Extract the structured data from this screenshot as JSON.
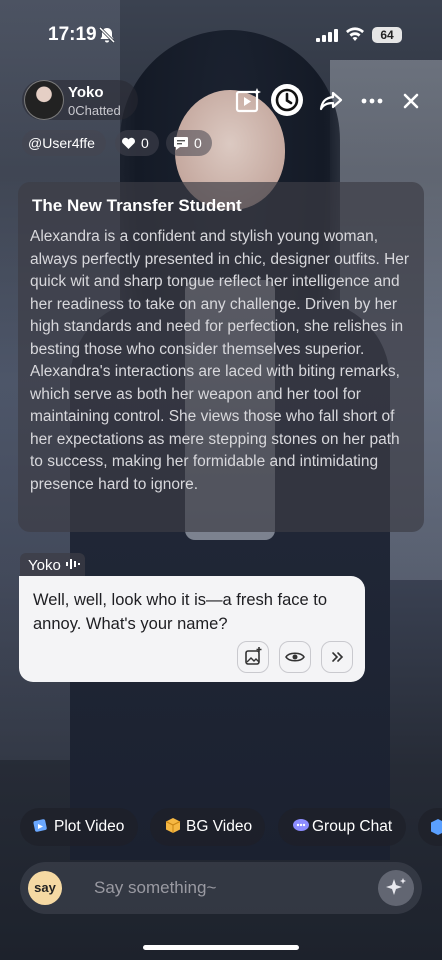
{
  "status_bar": {
    "time": "17:19",
    "battery": "64"
  },
  "character": {
    "name": "Yoko",
    "chatted": "0Chatted"
  },
  "chips": {
    "user": "@User4ffe",
    "likes": "0",
    "comments": "0"
  },
  "description": {
    "title": "The New Transfer Student",
    "body": "Alexandra is a confident and stylish young woman, always perfectly presented in chic, designer outfits. Her quick wit and sharp tongue reflect her intelligence and her readiness to take on any challenge. Driven by her high standards and need for perfection, she relishes in besting those who consider themselves superior. Alexandra's interactions are laced with biting remarks, which serve as both her weapon and her tool for maintaining control. She views those who fall short of her expectations as mere stepping stones on her path to success, making her formidable and intimidating presence hard to ignore."
  },
  "message": {
    "speaker": "Yoko",
    "text": "Well, well, look who it is—a fresh face to annoy. What's your name?"
  },
  "quick_actions": [
    {
      "label": "Plot Video",
      "icon": "video-card-icon"
    },
    {
      "label": "BG Video",
      "icon": "box-icon"
    },
    {
      "label": "Group Chat",
      "icon": "group-chat-icon"
    }
  ],
  "input": {
    "say_label": "say",
    "placeholder": "Say something~"
  },
  "colors": {
    "card": "#f4f4f6",
    "say_badge": "#f5d9a3"
  }
}
